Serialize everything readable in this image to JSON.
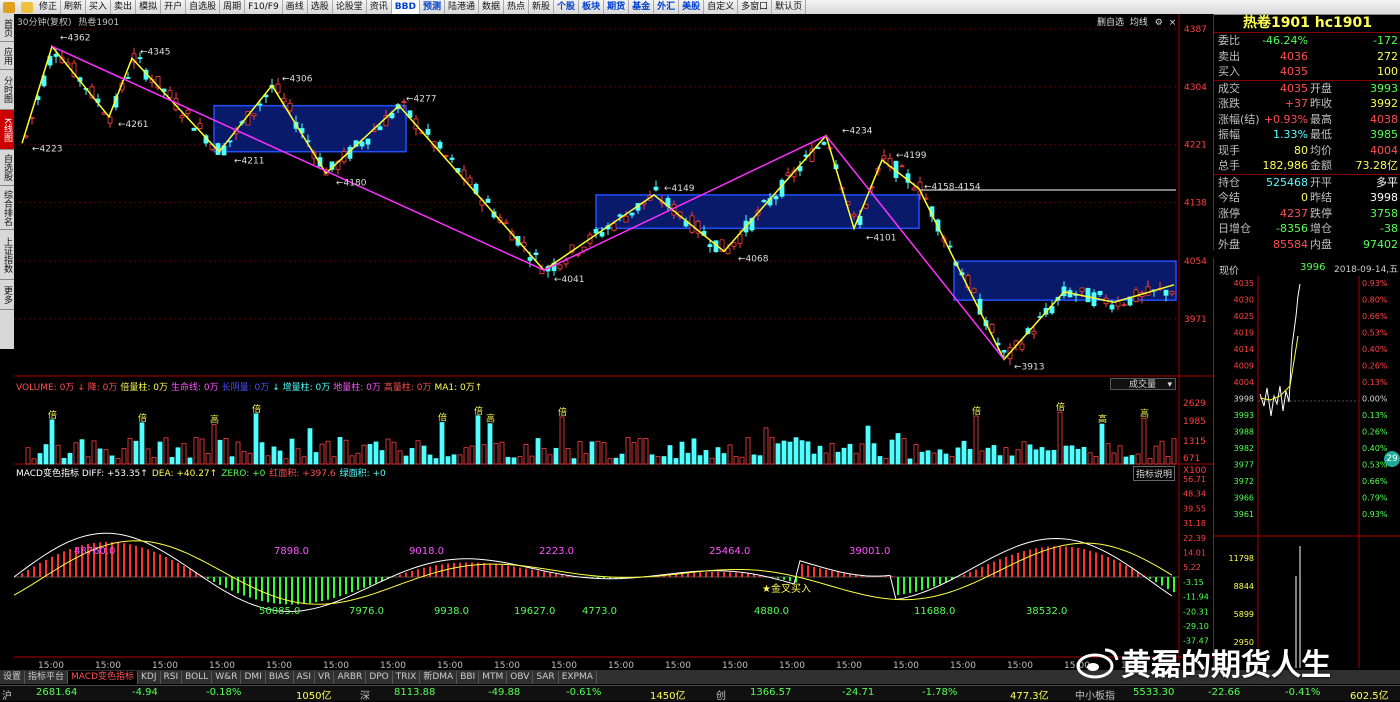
{
  "toolbar": {
    "items": [
      "修正",
      "刷新",
      "买入",
      "卖出",
      "模拟",
      "开户",
      "自选股",
      "周期",
      "F10/F9",
      "画线",
      "选股",
      "论股堂",
      "资讯",
      "BBD",
      "预测",
      "陆港通",
      "数据",
      "热点",
      "新股",
      "个股",
      "板块",
      "期货",
      "基金",
      "外汇",
      "美股",
      "自定义",
      "多窗口",
      "默认页"
    ],
    "blue": [
      "BBD",
      "预测",
      "个股",
      "板块",
      "期货",
      "基金",
      "外汇",
      "美股"
    ]
  },
  "leftnav": [
    "首页",
    "应用",
    "分时图",
    "K线图",
    "自选股",
    "综合排名",
    "上证指数",
    "更多"
  ],
  "chart": {
    "period_label": "30分钟(复权)",
    "name": "热卷1901",
    "top_right_buttons": [
      "删自选",
      "均线"
    ],
    "price_axis": [
      "4387",
      "4304",
      "4221",
      "4138",
      "4054",
      "3971"
    ],
    "annotations": [
      "4362",
      "4345",
      "4306",
      "4277",
      "4261",
      "4223",
      "4211",
      "4180",
      "4149",
      "4234",
      "4199",
      "4158-4154",
      "4101",
      "4068",
      "4041",
      "3913"
    ],
    "volume_header": [
      {
        "text": "VOLUME: 0万",
        "color": "#ff5050"
      },
      {
        "text": "↓ 降: 0万",
        "color": "#ff5050"
      },
      {
        "text": "倍量柱: 0万",
        "color": "#ffff55"
      },
      {
        "text": "生命线: 0万",
        "color": "#ff55ff"
      },
      {
        "text": "长阴量: 0万",
        "color": "#5050ff"
      },
      {
        "text": "↓ 增量柱: 0万",
        "color": "#55ffff"
      },
      {
        "text": "地量柱: 0万",
        "color": "#ff55ff"
      },
      {
        "text": "高量柱: 0万",
        "color": "#ff5050"
      },
      {
        "text": "MA1: 0万↑",
        "color": "#ffff55"
      }
    ],
    "volume_select": "成交量",
    "volume_axis": [
      "2629",
      "1985",
      "1315",
      "671",
      "X100"
    ],
    "volume_marks": [
      "倍",
      "倍",
      "高",
      "倍",
      "倍",
      "倍",
      "高",
      "倍",
      "倍",
      "倍",
      "高",
      "高",
      "倍",
      "倍",
      "倍",
      "倍",
      "高",
      "高",
      "倍"
    ],
    "macd_header": [
      {
        "text": "MACD变色指标 DIFF: +53.35↑",
        "color": "#ffffff"
      },
      {
        "text": "DEA: +40.27↑",
        "color": "#ffff55"
      },
      {
        "text": "ZERO: +0",
        "color": "#55ff55"
      },
      {
        "text": "红面积: +397.6",
        "color": "#ff5050"
      },
      {
        "text": "绿面积: +0",
        "color": "#55ffff"
      }
    ],
    "macd_button": "指标说明",
    "macd_axis": [
      "56.71",
      "48.34",
      "39.55",
      "31.18",
      "22.39",
      "14.01",
      "5.22",
      "-3.15",
      "-11.94",
      "-20.31",
      "-29.10",
      "-37.47"
    ],
    "macd_labels": [
      {
        "t": "48760.0",
        "c": "#ff55ff"
      },
      {
        "t": "50085.0",
        "c": "#55ff55"
      },
      {
        "t": "7898.0",
        "c": "#ff55ff"
      },
      {
        "t": "7976.0",
        "c": "#55ff55"
      },
      {
        "t": "9018.0",
        "c": "#ff55ff"
      },
      {
        "t": "9938.0",
        "c": "#55ff55"
      },
      {
        "t": "19627.0",
        "c": "#55ff55"
      },
      {
        "t": "2223.0",
        "c": "#ff55ff"
      },
      {
        "t": "4773.0",
        "c": "#55ff55"
      },
      {
        "t": "25464.0",
        "c": "#ff55ff"
      },
      {
        "t": "4880.0",
        "c": "#55ff55"
      },
      {
        "t": "39001.0",
        "c": "#ff55ff"
      },
      {
        "t": "11688.0",
        "c": "#55ff55"
      },
      {
        "t": "38532.0",
        "c": "#55ff55"
      }
    ],
    "golden_cross": "金叉买入",
    "time_labels": [
      "15:00",
      "15:00",
      "15:00",
      "15:00",
      "15:00",
      "15:00",
      "15:00",
      "15:00",
      "15:00",
      "15:00",
      "15:00",
      "15:00",
      "15:00",
      "15:00",
      "15:00",
      "15:00",
      "15:00",
      "15:00",
      "15:00",
      "15:00"
    ]
  },
  "quote": {
    "title": "热卷1901 hc1901",
    "rows": [
      {
        "l": "委比",
        "v": "-46.24%",
        "vc": "#55ff55",
        "l2": "",
        "v2": "-172",
        "v2c": "#55ff55"
      },
      {
        "l": "卖出",
        "v": "4036",
        "vc": "#ff5050",
        "l2": "",
        "v2": "272",
        "v2c": "#ffff55"
      },
      {
        "l": "买入",
        "v": "4035",
        "vc": "#ff5050",
        "l2": "",
        "v2": "100",
        "v2c": "#ffff55"
      },
      {
        "l": "成交",
        "v": "4035",
        "vc": "#ff5050",
        "l2": "开盘",
        "v2": "3993",
        "v2c": "#55ff55",
        "sep": true
      },
      {
        "l": "涨跌",
        "v": "+37",
        "vc": "#ff5050",
        "l2": "昨收",
        "v2": "3992",
        "v2c": "#ffff55"
      },
      {
        "l": "涨幅(结)",
        "v": "+0.93%",
        "vc": "#ff5050",
        "l2": "最高",
        "v2": "4038",
        "v2c": "#ff5050"
      },
      {
        "l": "振幅",
        "v": "1.33%",
        "vc": "#55ffff",
        "l2": "最低",
        "v2": "3985",
        "v2c": "#55ff55"
      },
      {
        "l": "现手",
        "v": "80",
        "vc": "#ffff55",
        "l2": "均价",
        "v2": "4004",
        "v2c": "#ff5050"
      },
      {
        "l": "总手",
        "v": "182,986",
        "vc": "#ffff55",
        "l2": "金额",
        "v2": "73.28亿",
        "v2c": "#ffff55"
      },
      {
        "l": "持仓",
        "v": "525468",
        "vc": "#55ffff",
        "l2": "开平",
        "v2": "多平",
        "v2c": "#ffffff",
        "sep": true
      },
      {
        "l": "今结",
        "v": "0",
        "vc": "#ffff55",
        "l2": "昨结",
        "v2": "3998",
        "v2c": "#ffffff"
      },
      {
        "l": "涨停",
        "v": "4237",
        "vc": "#ff5050",
        "l2": "跌停",
        "v2": "3758",
        "v2c": "#55ff55"
      },
      {
        "l": "日增仓",
        "v": "-8356",
        "vc": "#55ff55",
        "l2": "增仓",
        "v2": "-38",
        "v2c": "#55ff55"
      },
      {
        "l": "外盘",
        "v": "85584",
        "vc": "#ff5050",
        "l2": "内盘",
        "v2": "97402",
        "v2c": "#55ff55"
      }
    ]
  },
  "mini": {
    "label": "现价",
    "price": "3996",
    "date": "2018-09-14,五",
    "left_axis": [
      "4035",
      "4030",
      "4025",
      "4019",
      "4014",
      "4009",
      "4004",
      "3998",
      "3993",
      "3988",
      "3982",
      "3977",
      "3972",
      "3966",
      "3961",
      "11798",
      "8844",
      "5899",
      "2950"
    ],
    "right_axis": [
      "0.93%",
      "0.80%",
      "0.66%",
      "0.53%",
      "0.40%",
      "0.26%",
      "0.13%",
      "0.00%",
      "0.13%",
      "0.26%",
      "0.40%",
      "0.53%",
      "0.66%",
      "0.79%",
      "0.93%"
    ],
    "badge": "29"
  },
  "tabs": [
    "设置",
    "指标平台",
    "MACD变色指标",
    "KDJ",
    "RSI",
    "BOLL",
    "W&R",
    "DMI",
    "BIAS",
    "ASI",
    "VR",
    "ARBR",
    "DPO",
    "TRIX",
    "新DMA",
    "BBI",
    "MTM",
    "OBV",
    "SAR",
    "EXPMA"
  ],
  "index_bar": [
    {
      "t": "沪",
      "c": "#c0c0c0"
    },
    {
      "t": "2681.64",
      "c": "#55ff55"
    },
    {
      "t": "-4.94",
      "c": "#55ff55"
    },
    {
      "t": "-0.18%",
      "c": "#55ff55"
    },
    {
      "t": "1050亿",
      "c": "#ffff55"
    },
    {
      "t": "深",
      "c": "#c0c0c0"
    },
    {
      "t": "8113.88",
      "c": "#55ff55"
    },
    {
      "t": "-49.88",
      "c": "#55ff55"
    },
    {
      "t": "-0.61%",
      "c": "#55ff55"
    },
    {
      "t": "1450亿",
      "c": "#ffff55"
    },
    {
      "t": "创",
      "c": "#c0c0c0"
    },
    {
      "t": "1366.57",
      "c": "#55ff55"
    },
    {
      "t": "-24.71",
      "c": "#55ff55"
    },
    {
      "t": "-1.78%",
      "c": "#55ff55"
    },
    {
      "t": "477.3亿",
      "c": "#ffff55"
    },
    {
      "t": "中小板指",
      "c": "#c0c0c0"
    },
    {
      "t": "5533.30",
      "c": "#55ff55"
    },
    {
      "t": "-22.66",
      "c": "#55ff55"
    },
    {
      "t": "-0.41%",
      "c": "#55ff55"
    },
    {
      "t": "602.5亿",
      "c": "#ffff55"
    }
  ],
  "watermark": "黄磊的期货人生"
}
